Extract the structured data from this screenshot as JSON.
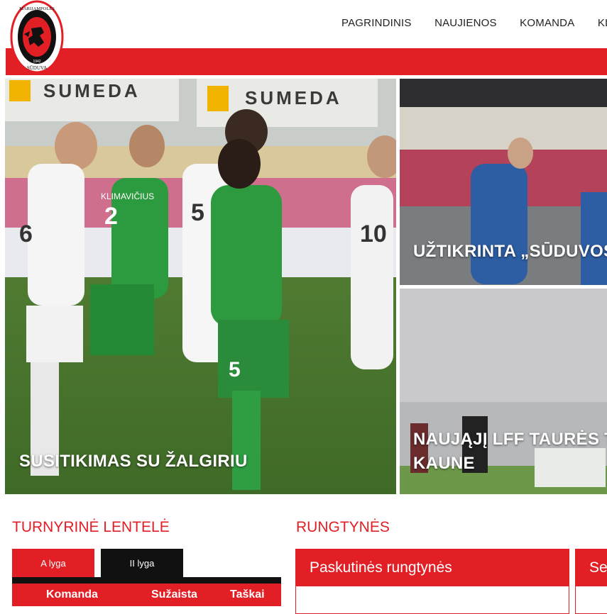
{
  "logo": {
    "top_text": "MARIJAMPOLĖS",
    "bottom_text": "SŪDUVA",
    "year": "1942",
    "icon": "club-crest-icon"
  },
  "nav": {
    "items": [
      "PAGRINDINIS",
      "NAUJIENOS",
      "KOMANDA",
      "KLU"
    ]
  },
  "hero": {
    "main_caption": "SUSITIKIMAS SU ŽALGIRIU",
    "banner_text": "SUMEDA",
    "top_caption": "UŽTIKRINTA „SŪDUVOS",
    "bottom_caption_line1": "NAUJĄJĮ LFF TAURĖS TU",
    "bottom_caption_line2": "KAUNE",
    "player_numbers": [
      "6",
      "2",
      "5",
      "10",
      "5"
    ],
    "player_name_1": "KLIMAVIČIUS"
  },
  "standings": {
    "title": "TURNYRINĖ LENTELĖ",
    "tabs": [
      "A lyga",
      "II lyga"
    ],
    "columns": [
      "Komanda",
      "Sužaista",
      "Taškai"
    ]
  },
  "matches": {
    "title": "RUNGTYNĖS",
    "cards": [
      "Paskutinės rungtynės",
      "Se"
    ]
  },
  "colors": {
    "accent": "#e11f25",
    "dark": "#111111"
  }
}
